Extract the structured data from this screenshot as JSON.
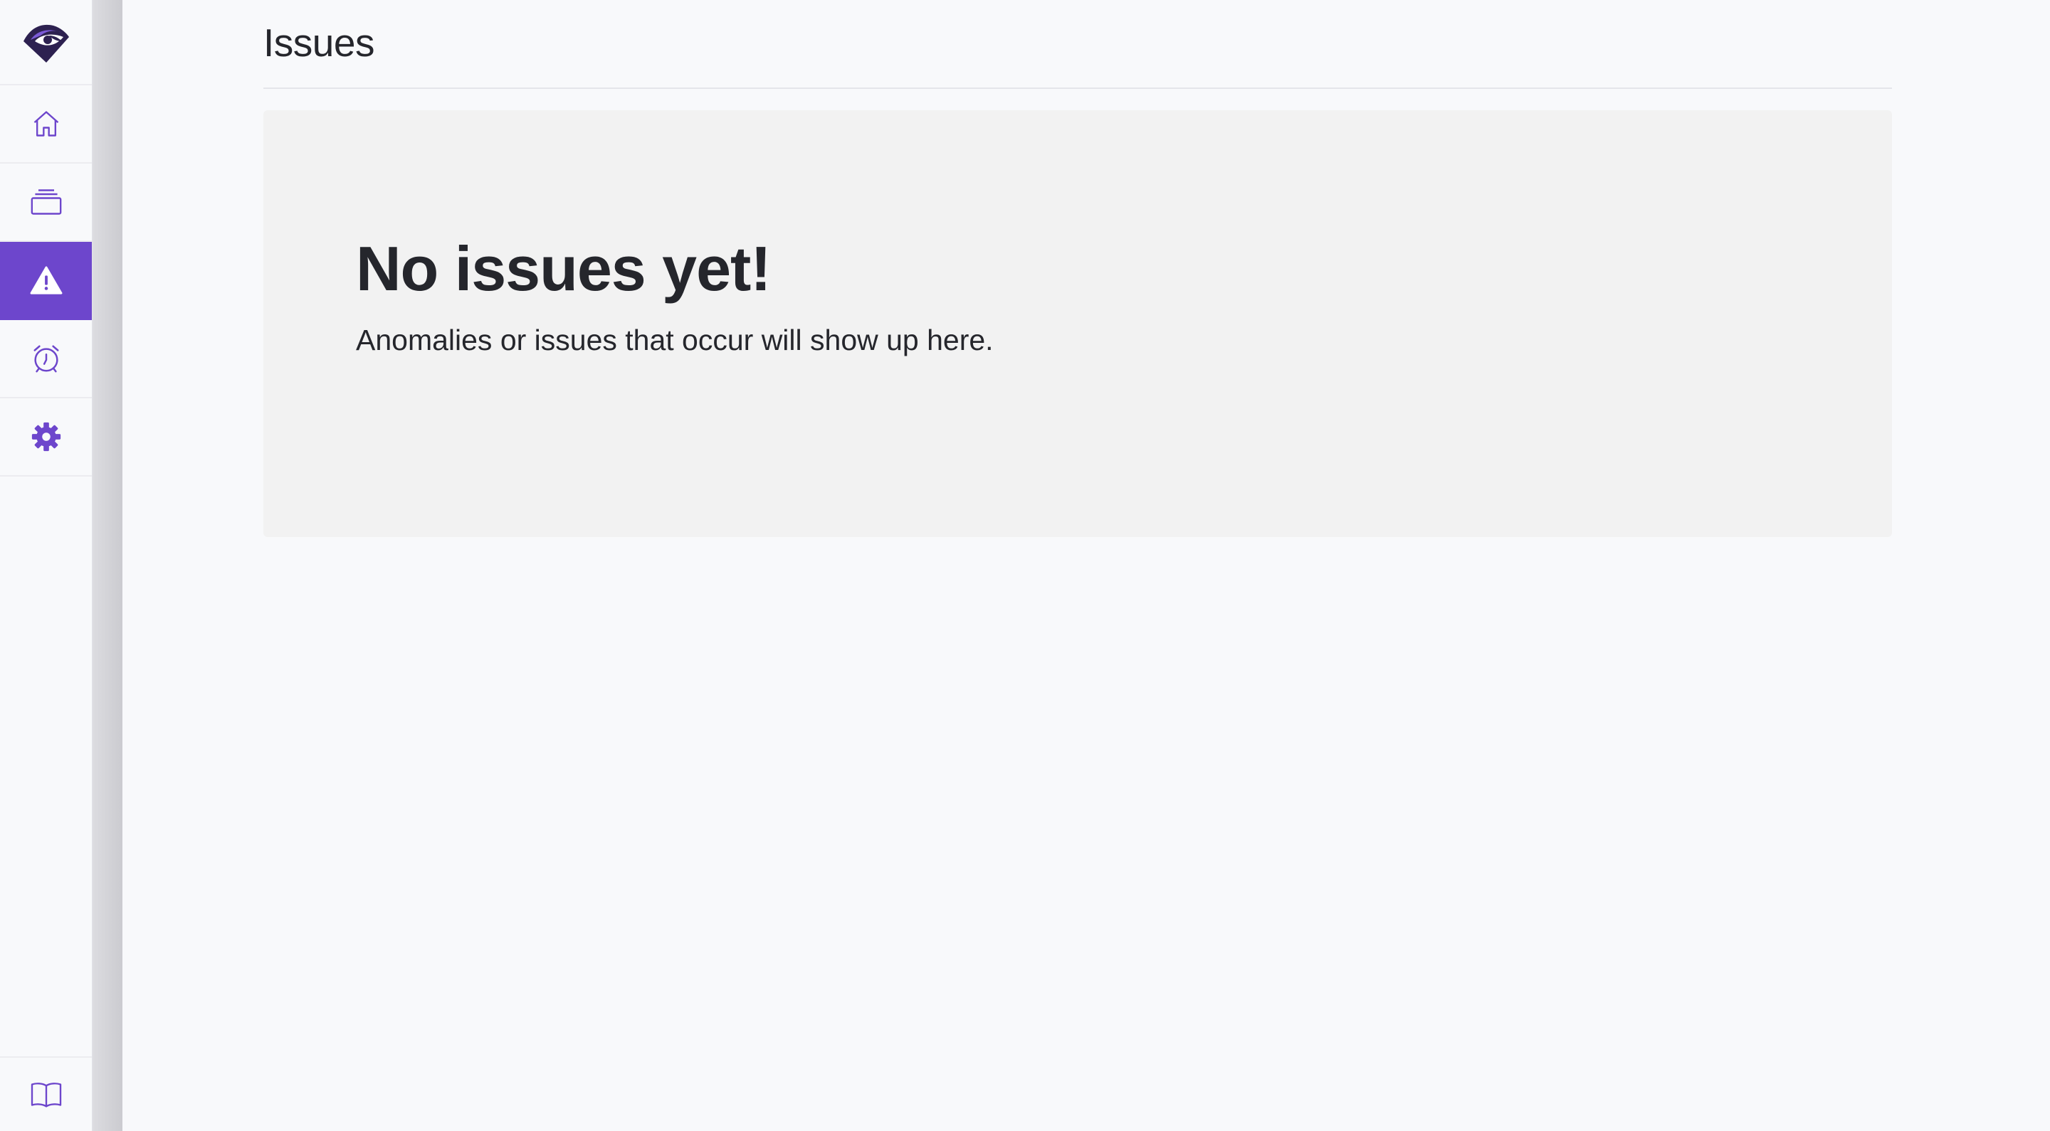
{
  "page": {
    "title": "Issues"
  },
  "empty_state": {
    "title": "No issues yet!",
    "message": "Anomalies or issues that occur will show up here."
  },
  "sidebar": {
    "logo_icon": "eye-logo-icon",
    "items": [
      {
        "icon": "home-icon",
        "active": false
      },
      {
        "icon": "stacked-layers-icon",
        "active": false
      },
      {
        "icon": "warning-triangle-icon",
        "active": true
      },
      {
        "icon": "alarm-clock-icon",
        "active": false
      },
      {
        "icon": "gear-icon",
        "active": false
      }
    ],
    "bottom_icon": "book-icon"
  },
  "colors": {
    "accent": "#6d46cc",
    "icon_inactive": "#6d46cc",
    "icon_active": "#ffffff",
    "background": "#f8f9fb",
    "panel": "#f2f2f2",
    "text": "#25262c"
  }
}
